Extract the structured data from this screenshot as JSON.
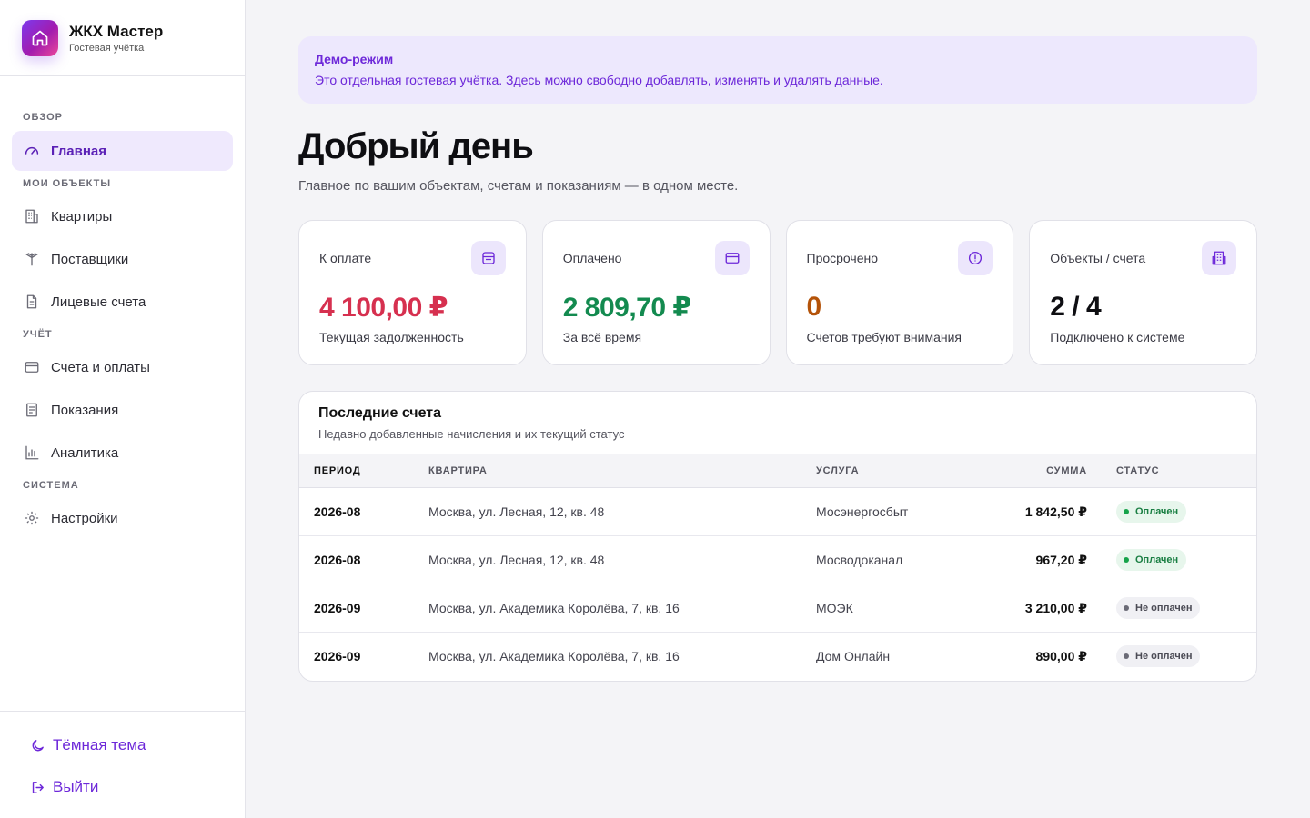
{
  "brand": {
    "title": "ЖКХ Мастер",
    "subtitle": "Гостевая учётка"
  },
  "nav": {
    "sections": [
      {
        "label": "ОБЗОР",
        "items": [
          {
            "label": "Главная",
            "icon": "gauge-icon",
            "active": true
          }
        ]
      },
      {
        "label": "МОИ ОБЪЕКТЫ",
        "items": [
          {
            "label": "Квартиры",
            "icon": "building-icon"
          },
          {
            "label": "Поставщики",
            "icon": "antenna-icon"
          },
          {
            "label": "Лицевые счета",
            "icon": "document-icon"
          }
        ]
      },
      {
        "label": "УЧЁТ",
        "items": [
          {
            "label": "Счета и оплаты",
            "icon": "credit-card-icon"
          },
          {
            "label": "Показания",
            "icon": "meter-readings-icon"
          },
          {
            "label": "Аналитика",
            "icon": "bar-chart-icon"
          }
        ]
      },
      {
        "label": "СИСТЕМА",
        "items": [
          {
            "label": "Настройки",
            "icon": "gear-icon"
          }
        ]
      }
    ]
  },
  "bottom": {
    "theme_label": "Тёмная тема",
    "logout_label": "Выйти"
  },
  "demo": {
    "title": "Демо-режим",
    "text": "Это отдельная гостевая учётка. Здесь можно свободно добавлять, изменять и удалять данные."
  },
  "greeting": "Добрый день",
  "subtitle": "Главное по вашим объектам, счетам и показаниям — в одном месте.",
  "cards": [
    {
      "label": "К оплате",
      "value": "4 100,00 ₽",
      "note": "Текущая задолженность",
      "color": "#d6304f",
      "icon": "wallet-icon"
    },
    {
      "label": "Оплачено",
      "value": "2 809,70 ₽",
      "note": "За всё время",
      "color": "#138a4f",
      "icon": "credit-card-icon"
    },
    {
      "label": "Просрочено",
      "value": "0",
      "note": "Счетов требуют внимания",
      "color": "#b45309",
      "icon": "alert-circle-icon"
    },
    {
      "label": "Объекты / счета",
      "value": "2 / 4",
      "note": "Подключено к системе",
      "color": "#0e0e12",
      "icon": "building-icon"
    }
  ],
  "bills": {
    "title": "Последние счета",
    "subtitle": "Недавно добавленные начисления и их текущий статус",
    "columns": {
      "period": "ПЕРИОД",
      "flat": "КВАРТИРА",
      "service": "УСЛУГА",
      "sum": "СУММА",
      "status": "СТАТУС"
    },
    "rows": [
      {
        "period": "2026-08",
        "flat": "Москва, ул. Лесная, 12, кв. 48",
        "service": "Мосэнергосбыт",
        "sum": "1 842,50 ₽",
        "status": "Оплачен",
        "paid": true
      },
      {
        "period": "2026-08",
        "flat": "Москва, ул. Лесная, 12, кв. 48",
        "service": "Мосводоканал",
        "sum": "967,20 ₽",
        "status": "Оплачен",
        "paid": true
      },
      {
        "period": "2026-09",
        "flat": "Москва, ул. Академика Королёва, 7, кв. 16",
        "service": "МОЭК",
        "sum": "3 210,00 ₽",
        "status": "Не оплачен",
        "paid": false
      },
      {
        "period": "2026-09",
        "flat": "Москва, ул. Академика Королёва, 7, кв. 16",
        "service": "Дом Онлайн",
        "sum": "890,00 ₽",
        "status": "Не оплачен",
        "paid": false
      }
    ]
  },
  "colors": {
    "accent": "#6d28d9",
    "accent_bg": "#efe9fd",
    "debt": "#d6304f",
    "paid": "#138a4f",
    "overdue": "#b45309"
  }
}
